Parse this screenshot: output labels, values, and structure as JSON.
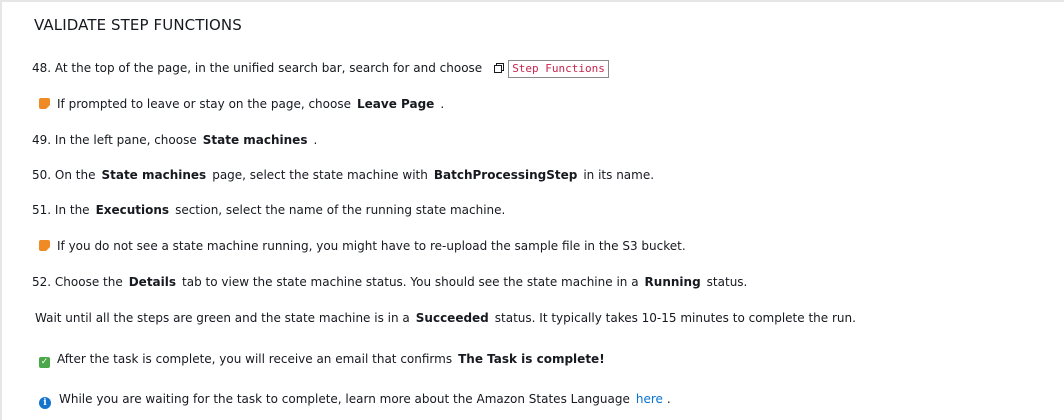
{
  "heading": "VALIDATE STEP FUNCTIONS",
  "step48": {
    "text": "48. At the top of the page, in the unified search bar, search for and choose",
    "icon": "copy-icon",
    "code": "Step Functions"
  },
  "note1": {
    "icon": "note-icon",
    "text": "If prompted to leave or stay on the page, choose",
    "bold": "Leave Page",
    "after": "."
  },
  "step49": {
    "text": "49. In the left pane, choose",
    "bold": "State machines",
    "after": "."
  },
  "step50": {
    "text": "50. On the",
    "bold1": "State machines",
    "mid": "page, select the state machine with",
    "bold2": "BatchProcessingStep",
    "after": "in its name."
  },
  "step51": {
    "text": "51. In the",
    "bold": "Executions",
    "after": "section, select the name of the running state machine."
  },
  "note2": {
    "icon": "note-icon",
    "text": "If you do not see a state machine running, you might have to re-upload the sample file in the S3 bucket."
  },
  "step52": {
    "text": "52. Choose the",
    "bold1": "Details",
    "mid": "tab to view the state machine status. You should see the state machine in a",
    "bold2": "Running",
    "after": "status."
  },
  "wait": {
    "text": "Wait until all the steps are green and the state machine is in a",
    "bold": "Succeeded",
    "after": "status. It typically takes 10-15 minutes to complete the run."
  },
  "success": {
    "icon": "check-icon",
    "text": "After the task is complete, you will receive an email that confirms",
    "bold": "The Task is complete!"
  },
  "info": {
    "icon": "info-icon",
    "text": "While you are waiting for the task to complete, learn more about the Amazon States Language",
    "link": "here",
    "after": "."
  },
  "colors": {
    "note": "#f08a24",
    "success": "#4aa84a",
    "info": "#1473cc",
    "link": "#0972d3",
    "code_text": "#c7254e"
  }
}
